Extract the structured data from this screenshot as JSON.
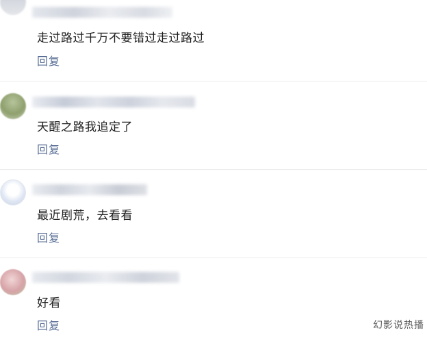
{
  "comments": [
    {
      "text": "走过路过千万不要错过走过路过",
      "reply_label": "回复"
    },
    {
      "text": "天醒之路我追定了",
      "reply_label": "回复"
    },
    {
      "text": "最近剧荒，去看看",
      "reply_label": "回复"
    },
    {
      "text": "好看",
      "reply_label": "回复"
    }
  ],
  "watermark": "幻影说热播",
  "colors": {
    "reply_link": "#5a6f96",
    "comment_text": "#222222",
    "divider": "#ececec"
  }
}
